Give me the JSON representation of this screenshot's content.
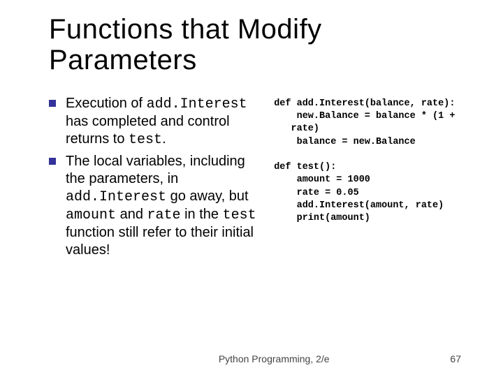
{
  "title": "Functions that Modify Parameters",
  "bullets": [
    {
      "parts": [
        {
          "t": "Execution of ",
          "code": false
        },
        {
          "t": "add.Interest",
          "code": true
        },
        {
          "t": " has completed and control returns to ",
          "code": false
        },
        {
          "t": "test",
          "code": true
        },
        {
          "t": ".",
          "code": false
        }
      ]
    },
    {
      "parts": [
        {
          "t": "The local variables, including the parameters, in ",
          "code": false
        },
        {
          "t": "add.Interest",
          "code": true
        },
        {
          "t": " go away, but ",
          "code": false
        },
        {
          "t": "amount",
          "code": true
        },
        {
          "t": " and ",
          "code": false
        },
        {
          "t": "rate",
          "code": true
        },
        {
          "t": " in the ",
          "code": false
        },
        {
          "t": "test",
          "code": true
        },
        {
          "t": " function still refer to their initial values!",
          "code": false
        }
      ]
    }
  ],
  "code": [
    "def add.Interest(balance, rate):",
    "    new.Balance = balance * (1 +",
    "   rate)",
    "    balance = new.Balance",
    "",
    "def test():",
    "    amount = 1000",
    "    rate = 0.05",
    "    add.Interest(amount, rate)",
    "    print(amount)"
  ],
  "footer": {
    "left": "Python Programming, 2/e",
    "right": "67"
  }
}
